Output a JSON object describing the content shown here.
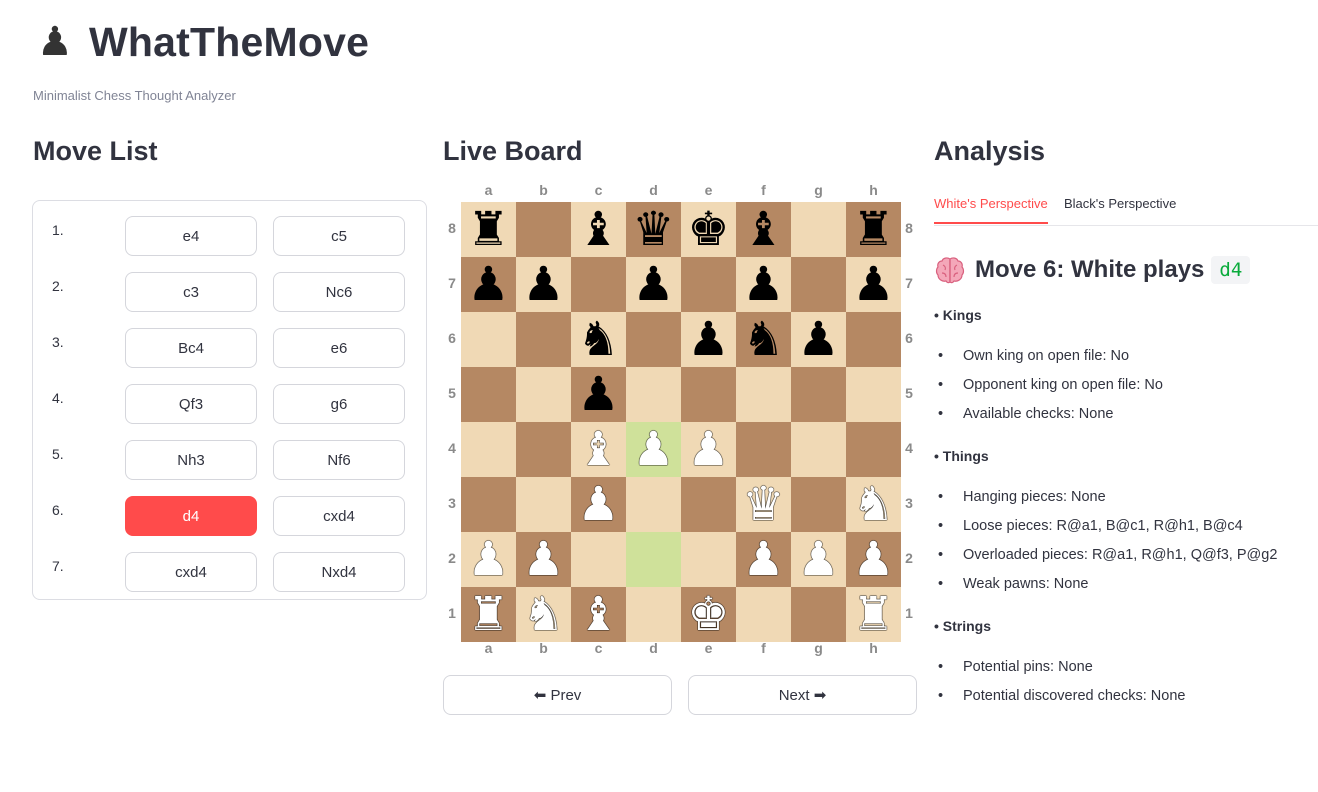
{
  "app": {
    "title": "WhatTheMove",
    "subtitle": "Minimalist Chess Thought Analyzer",
    "logo_icon": "pawn-icon"
  },
  "sections": {
    "moves": "Move List",
    "board": "Live Board",
    "analysis": "Analysis"
  },
  "move_list": [
    {
      "num": "1.",
      "white": "e4",
      "black": "c5"
    },
    {
      "num": "2.",
      "white": "c3",
      "black": "Nc6"
    },
    {
      "num": "3.",
      "white": "Bc4",
      "black": "e6"
    },
    {
      "num": "4.",
      "white": "Qf3",
      "black": "g6"
    },
    {
      "num": "5.",
      "white": "Nh3",
      "black": "Nf6"
    },
    {
      "num": "6.",
      "white": "d4",
      "black": "cxd4"
    },
    {
      "num": "7.",
      "white": "cxd4",
      "black": "Nxd4"
    }
  ],
  "active_move": "6-white",
  "board": {
    "files": [
      "a",
      "b",
      "c",
      "d",
      "e",
      "f",
      "g",
      "h"
    ],
    "ranks": [
      "8",
      "7",
      "6",
      "5",
      "4",
      "3",
      "2",
      "1"
    ],
    "position": [
      [
        "bR",
        "",
        "bB",
        "bQ",
        "bK",
        "bB",
        "",
        "bR"
      ],
      [
        "bP",
        "bP",
        "",
        "bP",
        "",
        "bP",
        "",
        "bP"
      ],
      [
        "",
        "",
        "bN",
        "",
        "bP",
        "bN",
        "bP",
        ""
      ],
      [
        "",
        "",
        "bP",
        "",
        "",
        "",
        "",
        ""
      ],
      [
        "",
        "",
        "wB",
        "wP",
        "wP",
        "",
        "",
        ""
      ],
      [
        "",
        "",
        "wP",
        "",
        "",
        "wQ",
        "",
        "wN"
      ],
      [
        "wP",
        "wP",
        "",
        "",
        "",
        "wP",
        "wP",
        "wP"
      ],
      [
        "wR",
        "wN",
        "wB",
        "",
        "wK",
        "",
        "",
        "wR"
      ]
    ],
    "highlight": [
      "d4",
      "d2"
    ],
    "colors": {
      "light": "#f0d9b5",
      "dark": "#b58863",
      "highlight": "#cfe19a"
    }
  },
  "nav": {
    "prev": "⬅ Prev",
    "next": "Next ➡"
  },
  "tabs": {
    "white": "White's Perspective",
    "black": "Black's Perspective",
    "active": "white"
  },
  "analysis": {
    "heading_icon": "brain-icon",
    "heading": "Move 6: White plays",
    "move_code": "d4",
    "groups": [
      {
        "title": "• Kings",
        "items": [
          "Own king on open file: No",
          "Opponent king on open file: No",
          "Available checks: None"
        ]
      },
      {
        "title": "• Things",
        "items": [
          "Hanging pieces: None",
          "Loose pieces: R@a1, B@c1, R@h1, B@c4",
          "Overloaded pieces: R@a1, R@h1, Q@f3, P@g2",
          "Weak pawns: None"
        ]
      },
      {
        "title": "• Strings",
        "items": [
          "Potential pins: None",
          "Potential discovered checks: None"
        ]
      }
    ]
  },
  "accent_color": "#ff4b4b",
  "code_color": "#09ab3b"
}
